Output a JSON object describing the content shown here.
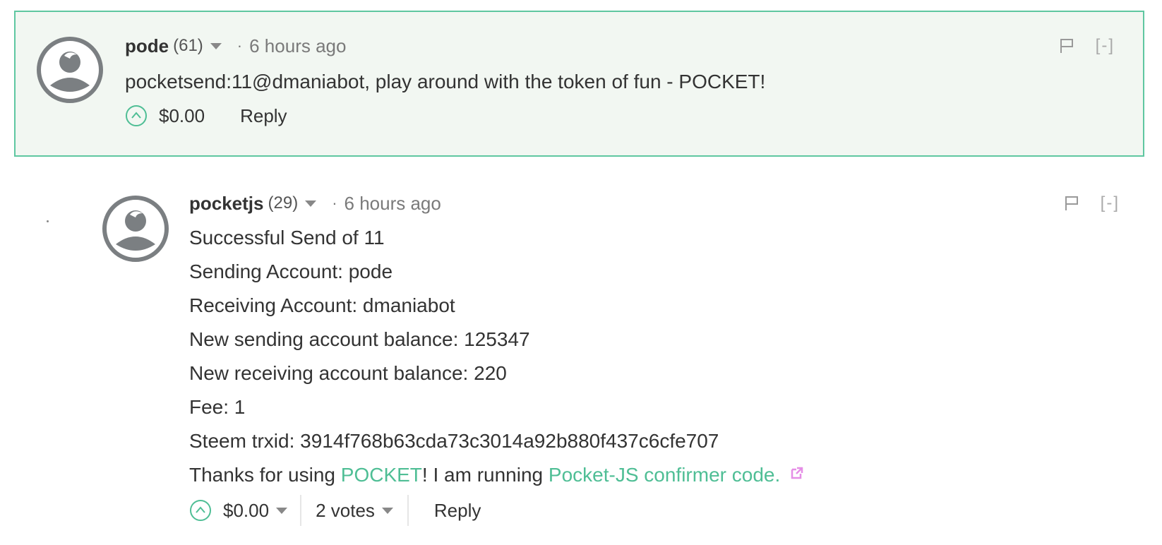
{
  "comments": [
    {
      "author": "pode",
      "reputation": "(61)",
      "separator": "·",
      "time": "6 hours ago",
      "collapse_label": "[-]",
      "text_lines": [
        {
          "plain": "pocketsend:11@dmaniabot, play around with the token of fun - POCKET!"
        }
      ],
      "payout": "$0.00",
      "reply_label": "Reply"
    },
    {
      "author": "pocketjs",
      "reputation": "(29)",
      "separator": "·",
      "time": "6 hours ago",
      "collapse_label": "[-]",
      "text_lines": [
        {
          "plain": "Successful Send of 11"
        },
        {
          "plain": "Sending Account: pode"
        },
        {
          "plain": "Receiving Account: dmaniabot"
        },
        {
          "plain": "New sending account balance: 125347"
        },
        {
          "plain": "New receiving account balance: 220"
        },
        {
          "plain": "Fee: 1"
        },
        {
          "plain": "Steem trxid: 3914f768b63cda73c3014a92b880f437c6cfe707"
        }
      ],
      "last_line": {
        "prefix": "Thanks for using ",
        "link1": "POCKET",
        "middle": "! I am running ",
        "link2": "Pocket-JS confirmer code."
      },
      "payout": "$0.00",
      "votes": "2 votes",
      "reply_label": "Reply"
    }
  ],
  "icons": {
    "avatar": "default-avatar-icon",
    "flag": "flag-icon",
    "upvote": "upvote-chevron-icon",
    "dropdown": "caret-down-icon",
    "external": "external-link-icon"
  },
  "colors": {
    "highlight_bg": "#f2f7f2",
    "highlight_border": "#5fc7a1",
    "link": "#4fbe95",
    "external_icon": "#e58ee6"
  }
}
